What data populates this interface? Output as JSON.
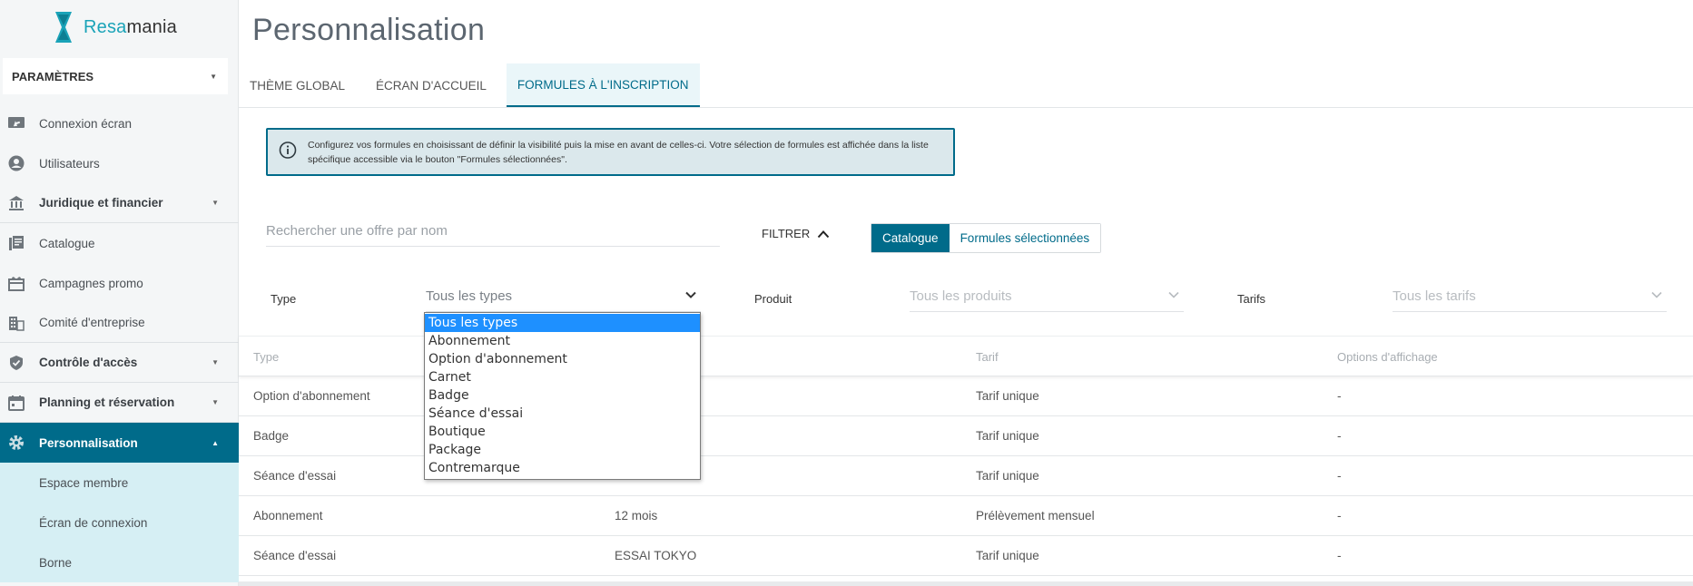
{
  "brand": {
    "name_part1": "Resa",
    "name_part2": "mania"
  },
  "sidebar": {
    "section_label": "PARAMÈTRES",
    "items": [
      {
        "label": "Connexion écran",
        "icon": "screen-share-icon"
      },
      {
        "label": "Utilisateurs",
        "icon": "user-circle-icon"
      },
      {
        "label": "Juridique et financier",
        "icon": "bank-icon"
      },
      {
        "label": "Catalogue",
        "icon": "catalogue-icon"
      },
      {
        "label": "Campagnes promo",
        "icon": "gift-icon"
      },
      {
        "label": "Comité d'entreprise",
        "icon": "building-icon"
      },
      {
        "label": "Contrôle d'accès",
        "icon": "shield-check-icon"
      },
      {
        "label": "Planning et réservation",
        "icon": "calendar-icon"
      },
      {
        "label": "Personnalisation",
        "icon": "gear-icon"
      }
    ],
    "sub_items": [
      {
        "label": "Espace membre"
      },
      {
        "label": "Écran de connexion"
      },
      {
        "label": "Borne"
      }
    ]
  },
  "main": {
    "title": "Personnalisation",
    "tabs": [
      {
        "label": "THÈME GLOBAL"
      },
      {
        "label": "ÉCRAN D'ACCUEIL"
      },
      {
        "label": "FORMULES À L'INSCRIPTION"
      }
    ],
    "info_text": "Configurez vos formules en choisissant de définir la visibilité puis la mise en avant de celles-ci. Votre sélection de formules est affichée dans la liste spécifique accessible via le bouton \"Formules sélectionnées\".",
    "search_placeholder": "Rechercher une offre par nom",
    "filter_label": "FILTRER",
    "segment": {
      "catalogue": "Catalogue",
      "selected": "Formules sélectionnées"
    },
    "filters": {
      "type_label": "Type",
      "type_value": "Tous les types",
      "product_label": "Produit",
      "product_value": "Tous les produits",
      "tarif_label": "Tarifs",
      "tarif_value": "Tous les tarifs"
    },
    "table": {
      "headers": [
        "Type",
        "Tarif",
        "Options d'affichage"
      ],
      "rows": [
        {
          "type": "Option d'abonnement",
          "product": "",
          "tarif": "Tarif unique",
          "options": "-"
        },
        {
          "type": "Badge",
          "product": "",
          "tarif": "Tarif unique",
          "options": "-"
        },
        {
          "type": "Séance d'essai",
          "product": "",
          "tarif": "Tarif unique",
          "options": "-"
        },
        {
          "type": "Abonnement",
          "product": "12 mois",
          "tarif": "Prélèvement mensuel",
          "options": "-"
        },
        {
          "type": "Séance d'essai",
          "product": "ESSAI TOKYO",
          "tarif": "Tarif unique",
          "options": "-"
        }
      ]
    },
    "type_dropdown": {
      "options": [
        "Tous les types",
        "Abonnement",
        "Option d'abonnement",
        "Carnet",
        "Badge",
        "Séance d'essai",
        "Boutique",
        "Package",
        "Contremarque"
      ]
    }
  },
  "colors": {
    "primary": "#006b8a",
    "accent": "#1aa3b8",
    "highlight": "#1e90ff"
  }
}
